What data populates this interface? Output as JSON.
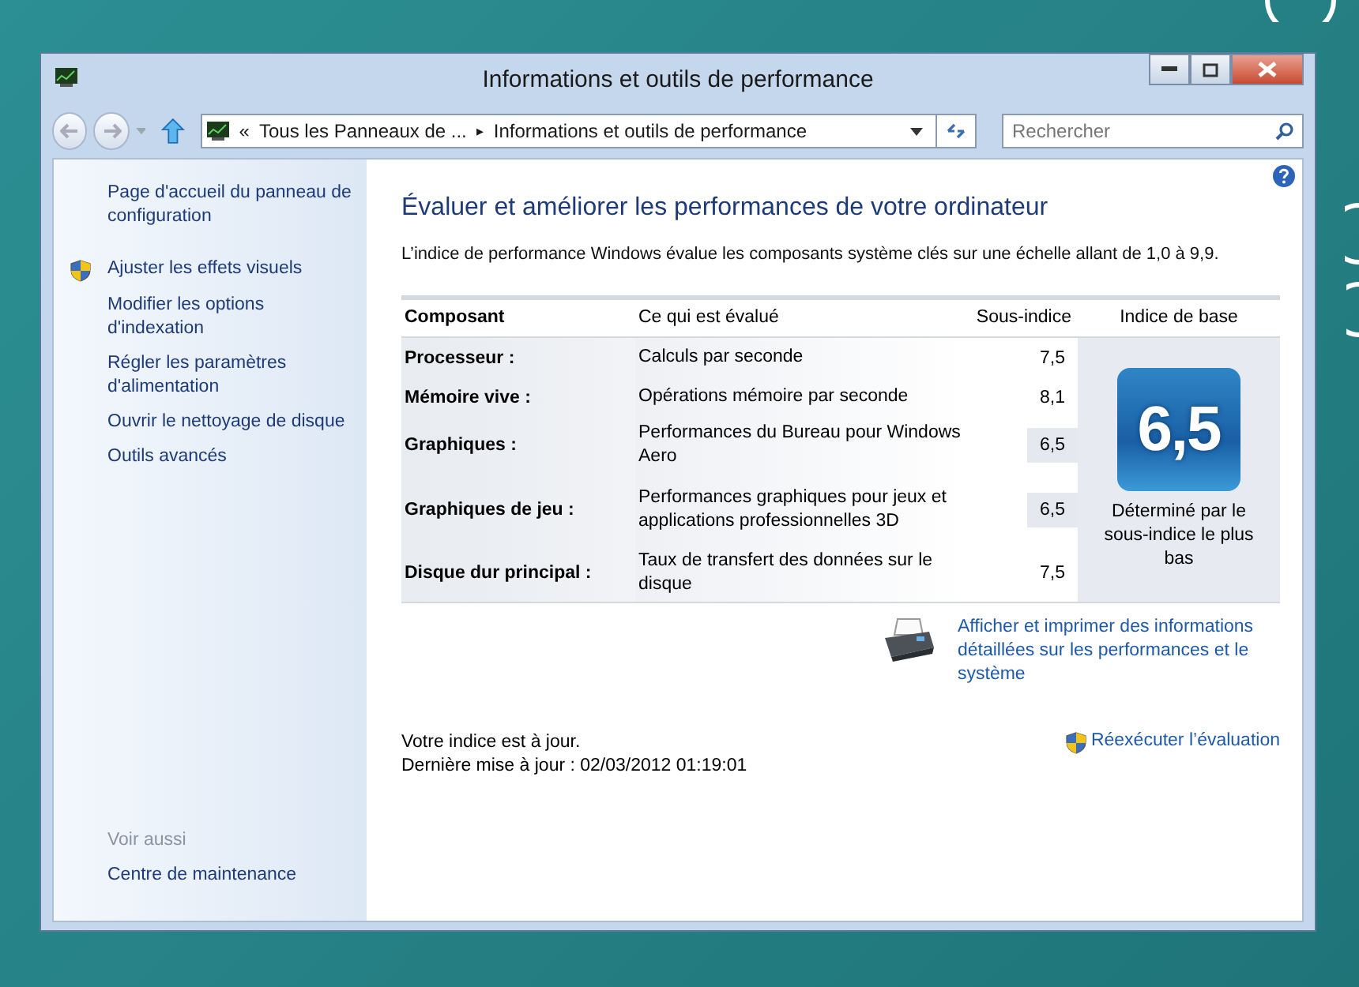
{
  "window": {
    "title": "Informations et outils de performance"
  },
  "address_bar": {
    "chevron": "«",
    "segments": [
      "Tous les Panneaux de ...",
      "Informations et outils de performance"
    ],
    "separator": "▸"
  },
  "search": {
    "placeholder": "Rechercher"
  },
  "sidebar": {
    "items": [
      {
        "label": "Page d'accueil du panneau de configuration",
        "shield": false
      },
      {
        "label": "Ajuster les effets visuels",
        "shield": true
      },
      {
        "label": "Modifier les options d'indexation",
        "shield": false
      },
      {
        "label": "Régler les paramètres d'alimentation",
        "shield": false
      },
      {
        "label": "Ouvrir le nettoyage de disque",
        "shield": false
      },
      {
        "label": "Outils avancés",
        "shield": false
      }
    ],
    "see_also": {
      "heading": "Voir aussi",
      "links": [
        "Centre de maintenance"
      ]
    }
  },
  "main": {
    "heading": "Évaluer et améliorer les performances de votre ordinateur",
    "intro": "L’indice de performance Windows évalue les composants système clés sur une échelle allant de 1,0 à 9,9.",
    "table": {
      "columns": [
        "Composant",
        "Ce qui est évalué",
        "Sous-indice",
        "Indice de base"
      ],
      "rows": [
        {
          "component": "Processeur :",
          "rated": "Calculs par seconde",
          "score": "7,5",
          "lowest": false
        },
        {
          "component": "Mémoire vive :",
          "rated": "Opérations mémoire par seconde",
          "score": "8,1",
          "lowest": false
        },
        {
          "component": "Graphiques :",
          "rated": "Performances du Bureau pour Windows Aero",
          "score": "6,5",
          "lowest": true
        },
        {
          "component": "Graphiques de jeu :",
          "rated": "Performances graphiques pour jeux et applications professionnelles 3D",
          "score": "6,5",
          "lowest": true
        },
        {
          "component": "Disque dur principal :",
          "rated": "Taux de transfert des données sur le disque",
          "score": "7,5",
          "lowest": false
        }
      ],
      "base_score": "6,5",
      "base_note": "Déterminé par le sous-indice le plus bas"
    },
    "print_link": "Afficher et imprimer des informations détaillées sur les performances et le système",
    "status": [
      "Votre indice est à jour.",
      "Dernière mise à jour : 02/03/2012 01:19:01"
    ],
    "rerun_link": "Réexécuter l’évaluation"
  }
}
